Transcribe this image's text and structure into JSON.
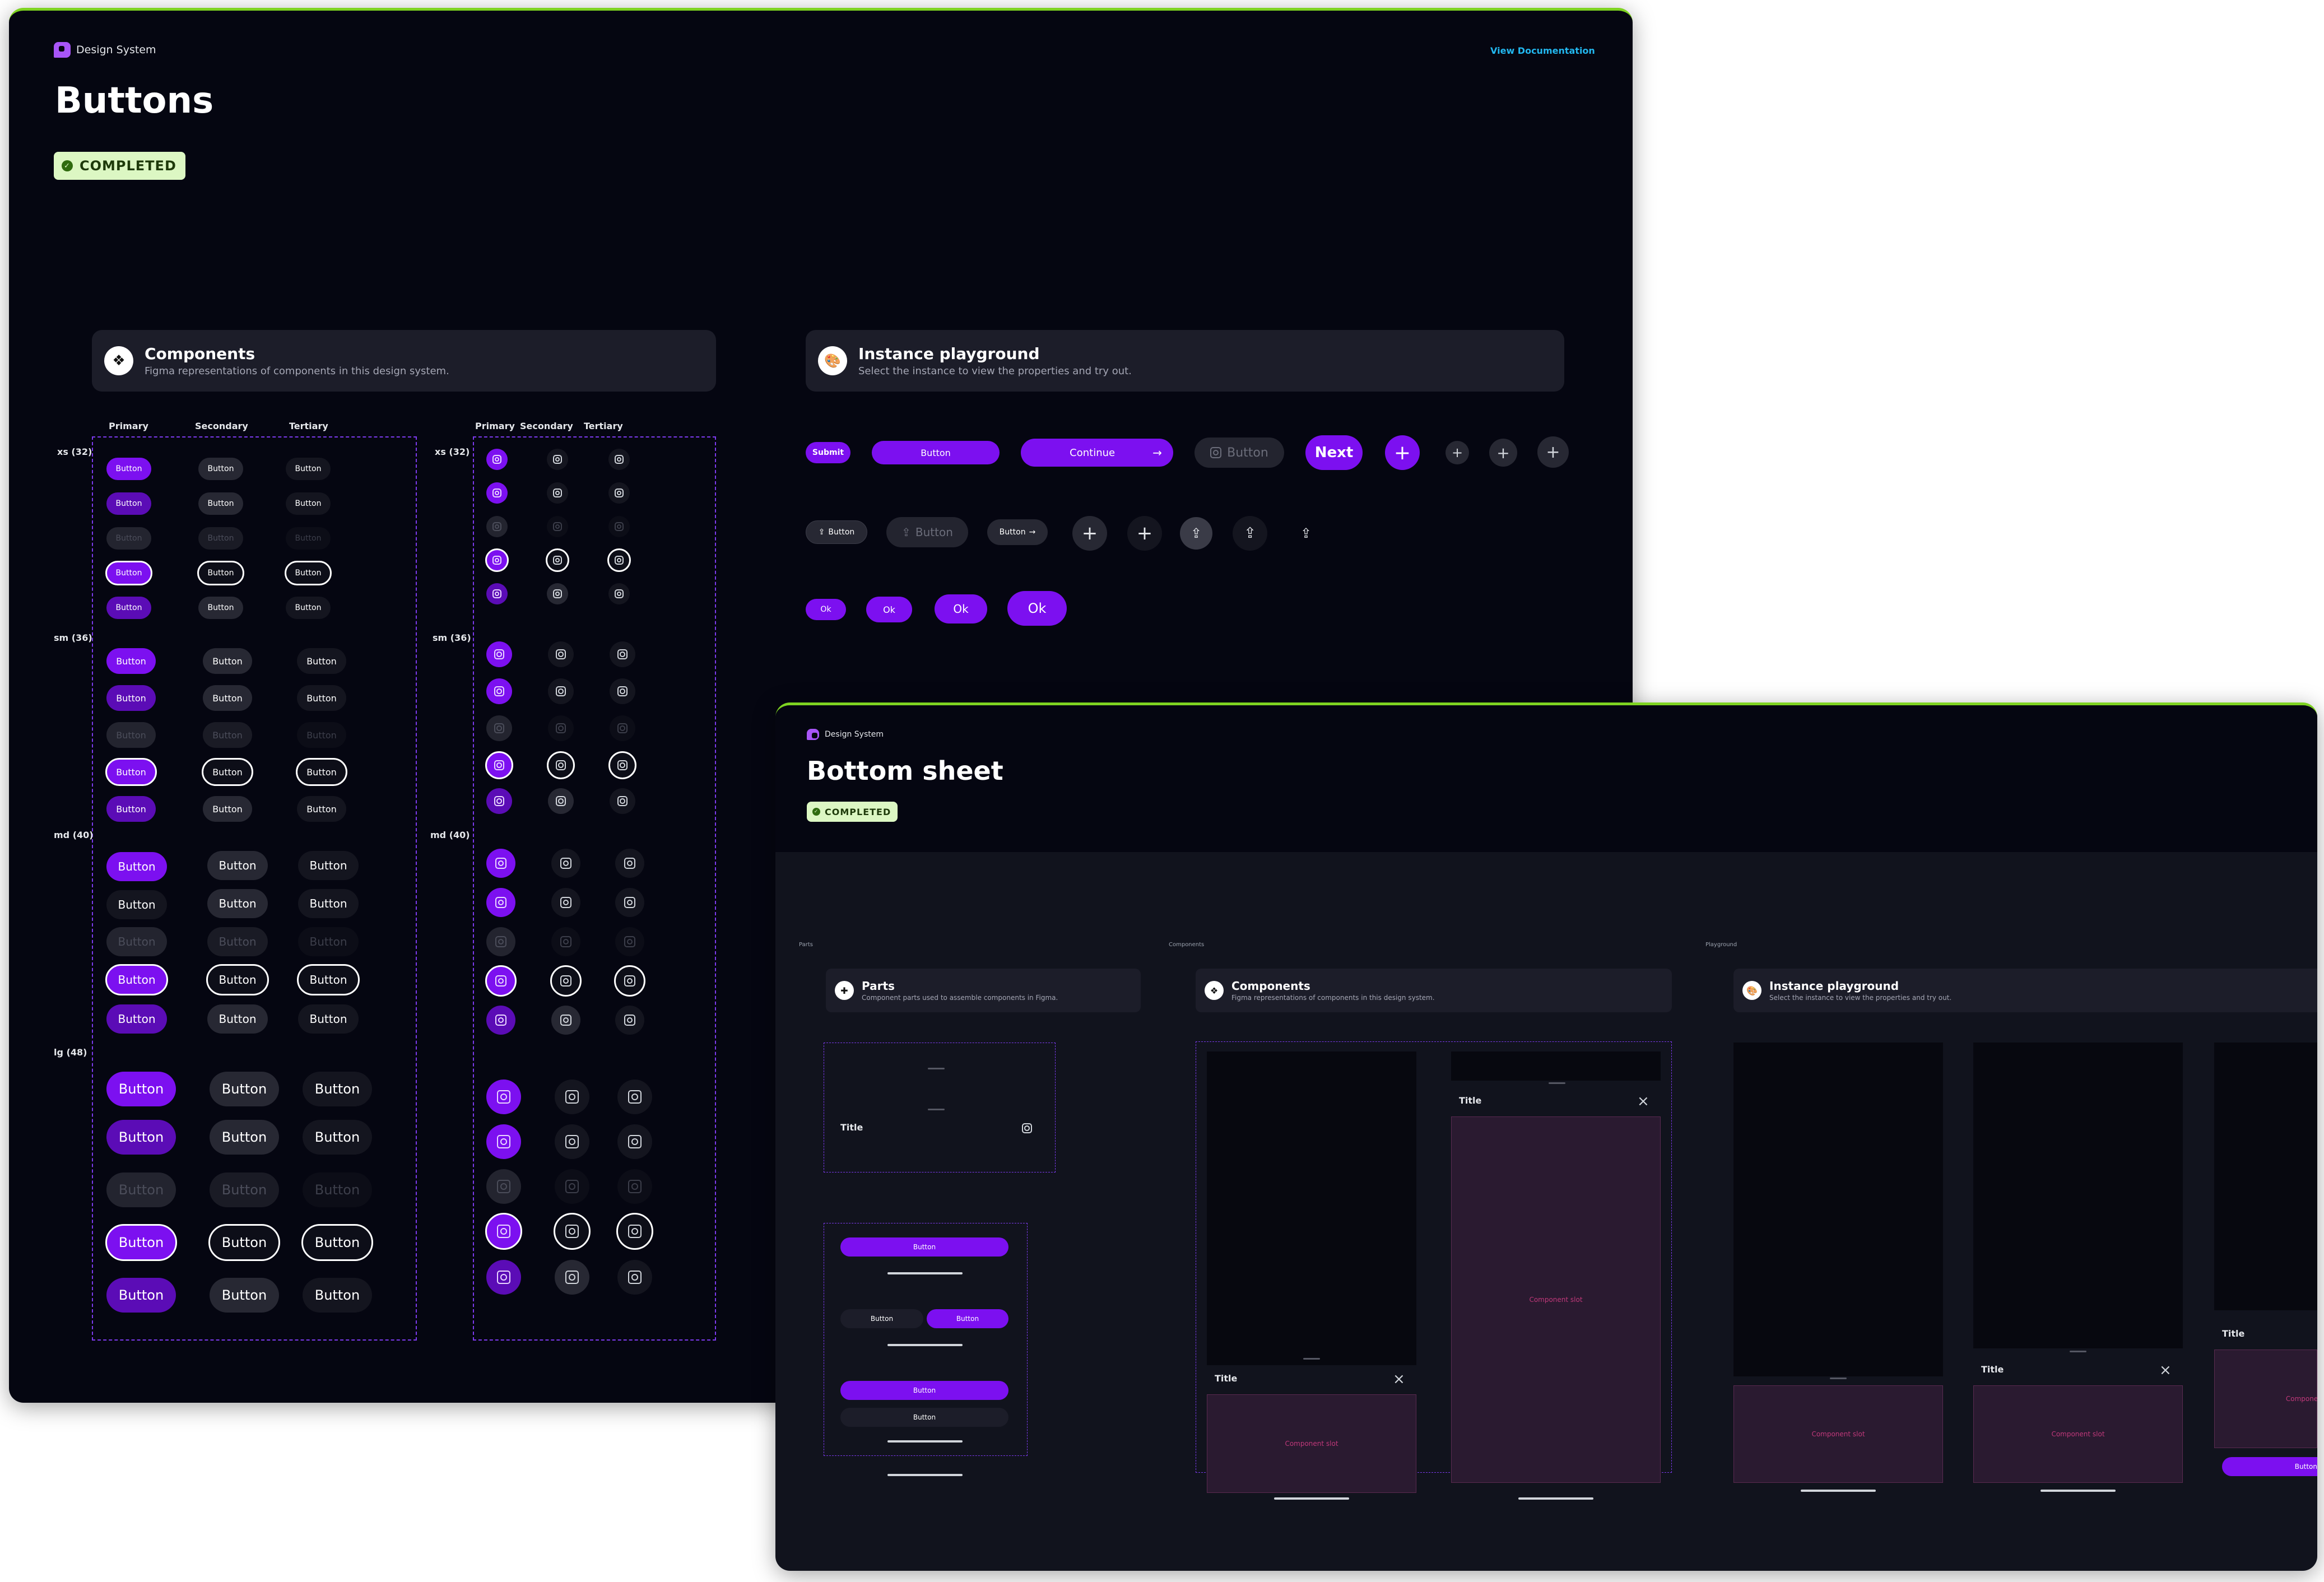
{
  "buttons_page": {
    "brand": "Design System",
    "title": "Buttons",
    "status": "COMPLETED",
    "doc_link": "View Documentation",
    "components_card": {
      "title": "Components",
      "subtitle": "Figma representations of components in this design system."
    },
    "playground_card": {
      "title": "Instance playground",
      "subtitle": "Select the instance to view the properties and try out."
    },
    "columns": [
      "Primary",
      "Secondary",
      "Tertiary"
    ],
    "size_labels": [
      "xs (32)",
      "sm (36)",
      "md (40)",
      "lg (48)"
    ],
    "button_label": "Button",
    "playground": {
      "submit": "Submit",
      "button": "Button",
      "continue": "Continue",
      "next": "Next",
      "ok": "Ok"
    },
    "icons": {
      "placeholder": "focus-frame-icon",
      "arrow": "arrow-right-icon",
      "plus": "plus-icon",
      "share": "share-icon",
      "check": "check-icon",
      "components": "component-diamond-icon",
      "palette": "palette-icon"
    }
  },
  "bottom_sheet_page": {
    "brand": "Design System",
    "title": "Bottom sheet",
    "status": "COMPLETED",
    "sections": [
      "Parts",
      "Components",
      "Playground"
    ],
    "parts_card": {
      "title": "Parts",
      "subtitle": "Component parts used to assemble components in Figma."
    },
    "components_card": {
      "title": "Components",
      "subtitle": "Figma representations of components in this design system."
    },
    "playground_card": {
      "title": "Instance playground",
      "subtitle": "Select the instance to view the properties and try out."
    },
    "sheet_title": "Title",
    "slot_label": "Component slot",
    "button_label": "Button"
  },
  "colors": {
    "primary": "#7c10f0",
    "accent_green": "#7ed321",
    "link": "#22b8f0",
    "badge_bg": "#dcf7c3",
    "dashed": "#7c3aed"
  }
}
